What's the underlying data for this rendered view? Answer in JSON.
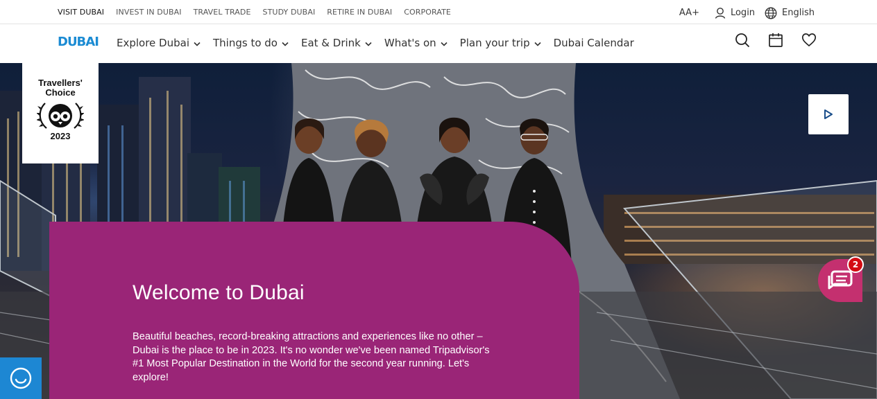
{
  "topbar": {
    "links": [
      "VISIT DUBAI",
      "INVEST IN DUBAI",
      "TRAVEL TRADE",
      "STUDY DUBAI",
      "RETIRE IN DUBAI",
      "CORPORATE"
    ],
    "font_size_label": "AA+",
    "login_label": "Login",
    "language_label": "English"
  },
  "nav": {
    "logo_text": "DUBAI",
    "items": [
      {
        "label": "Explore Dubai",
        "dropdown": true
      },
      {
        "label": "Things to do",
        "dropdown": true
      },
      {
        "label": "Eat & Drink",
        "dropdown": true
      },
      {
        "label": "What's on",
        "dropdown": true
      },
      {
        "label": "Plan your trip",
        "dropdown": true
      },
      {
        "label": "Dubai Calendar",
        "dropdown": false
      }
    ],
    "icons": [
      "search-icon",
      "calendar-icon",
      "heart-icon"
    ]
  },
  "hero": {
    "badge_title": "Travellers' Choice",
    "badge_year": "2023",
    "heading": "Welcome to Dubai",
    "body": "Beautiful beaches, record-breaking attractions and experiences like no other – Dubai is the place to be in 2023. It's no wonder we've been named Tripadvisor's #1 Most Popular Destination in the World for the second year running. Let's explore!",
    "chat_notifications": "2"
  },
  "colors": {
    "panel": "#9a2577",
    "chat_button": "#c4306f",
    "assist_button": "#1d87d3",
    "logo_blue": "#1b8bd3",
    "notification_red": "#d30c13"
  }
}
